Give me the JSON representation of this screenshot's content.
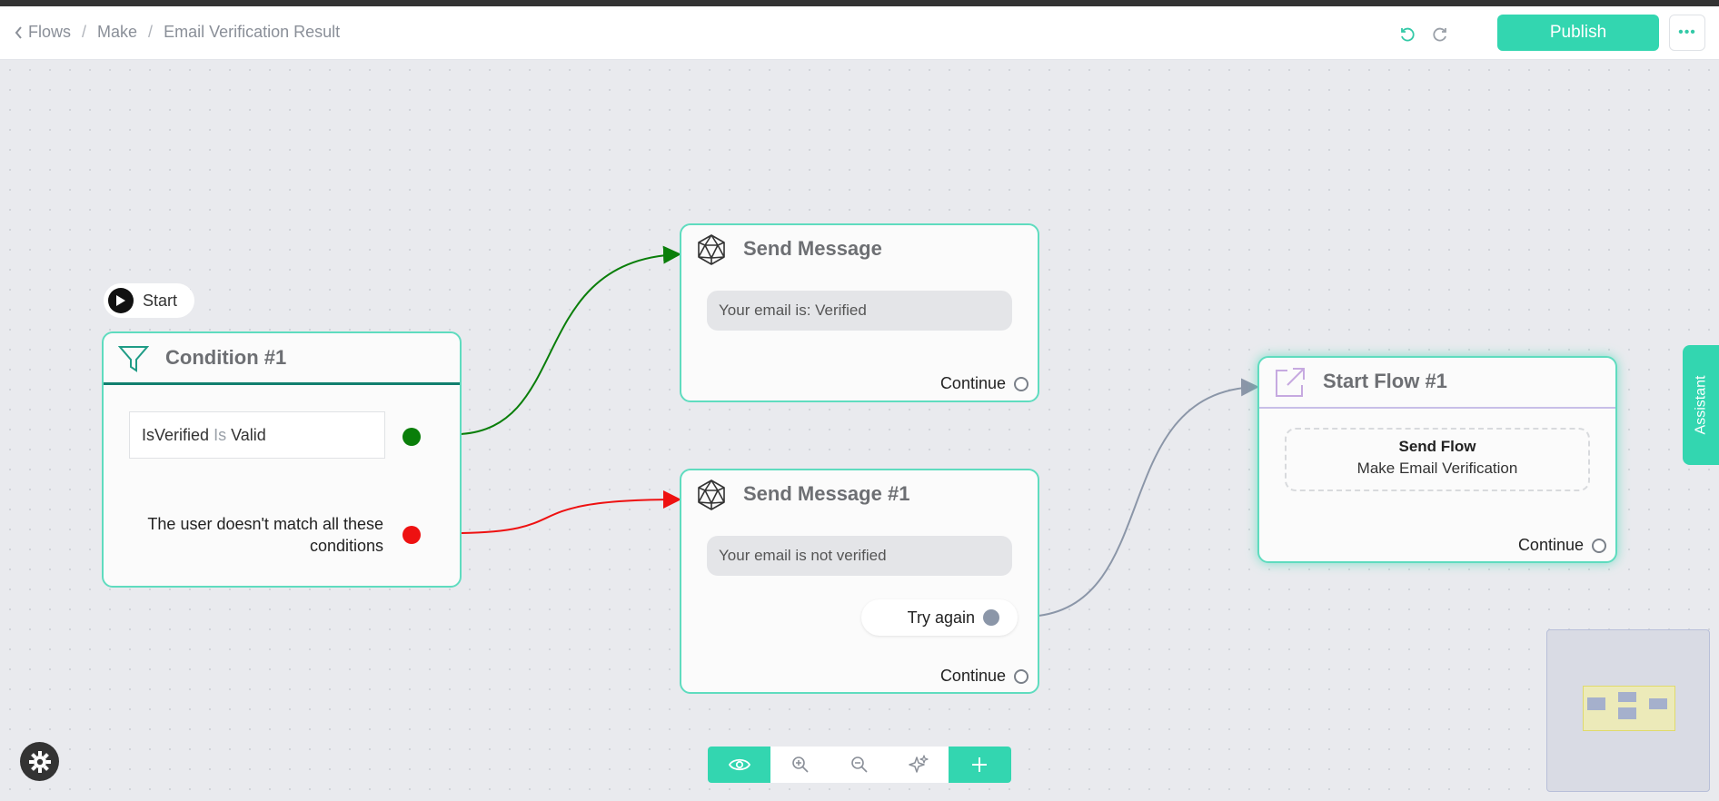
{
  "header": {
    "breadcrumb": {
      "back_label": "Flows",
      "section": "Make",
      "current": "Email Verification Result"
    },
    "publish_label": "Publish",
    "more_label": "•••"
  },
  "start_pill": {
    "label": "Start"
  },
  "condition_node": {
    "title": "Condition #1",
    "condition": {
      "field": "IsVerified",
      "operator": "Is",
      "value": "Valid"
    },
    "fallback_text_line1": "The user doesn't match all these",
    "fallback_text_line2": "conditions"
  },
  "send_message_node": {
    "title": "Send Message",
    "message": "Your email is: Verified",
    "continue_label": "Continue"
  },
  "send_message_1_node": {
    "title": "Send Message #1",
    "message": "Your email is not verified",
    "button_label": "Try again",
    "continue_label": "Continue"
  },
  "start_flow_node": {
    "title": "Start Flow #1",
    "action_title": "Send Flow",
    "action_flow": "Make Email Verification",
    "continue_label": "Continue"
  },
  "assistant_label": "Assistant",
  "colors": {
    "accent": "#33d6b0",
    "node_border": "#5fdcbf",
    "true_branch": "#0a7e0a",
    "false_branch": "#ee1111",
    "edge_gray": "#8b96a8"
  },
  "icons": [
    "chevron-left-icon",
    "undo-icon",
    "redo-icon",
    "filter-icon",
    "icosahedron-icon",
    "external-link-icon",
    "eye-icon",
    "zoom-in-icon",
    "zoom-out-icon",
    "sparkle-icon",
    "plus-icon",
    "gear-icon",
    "play-icon"
  ]
}
